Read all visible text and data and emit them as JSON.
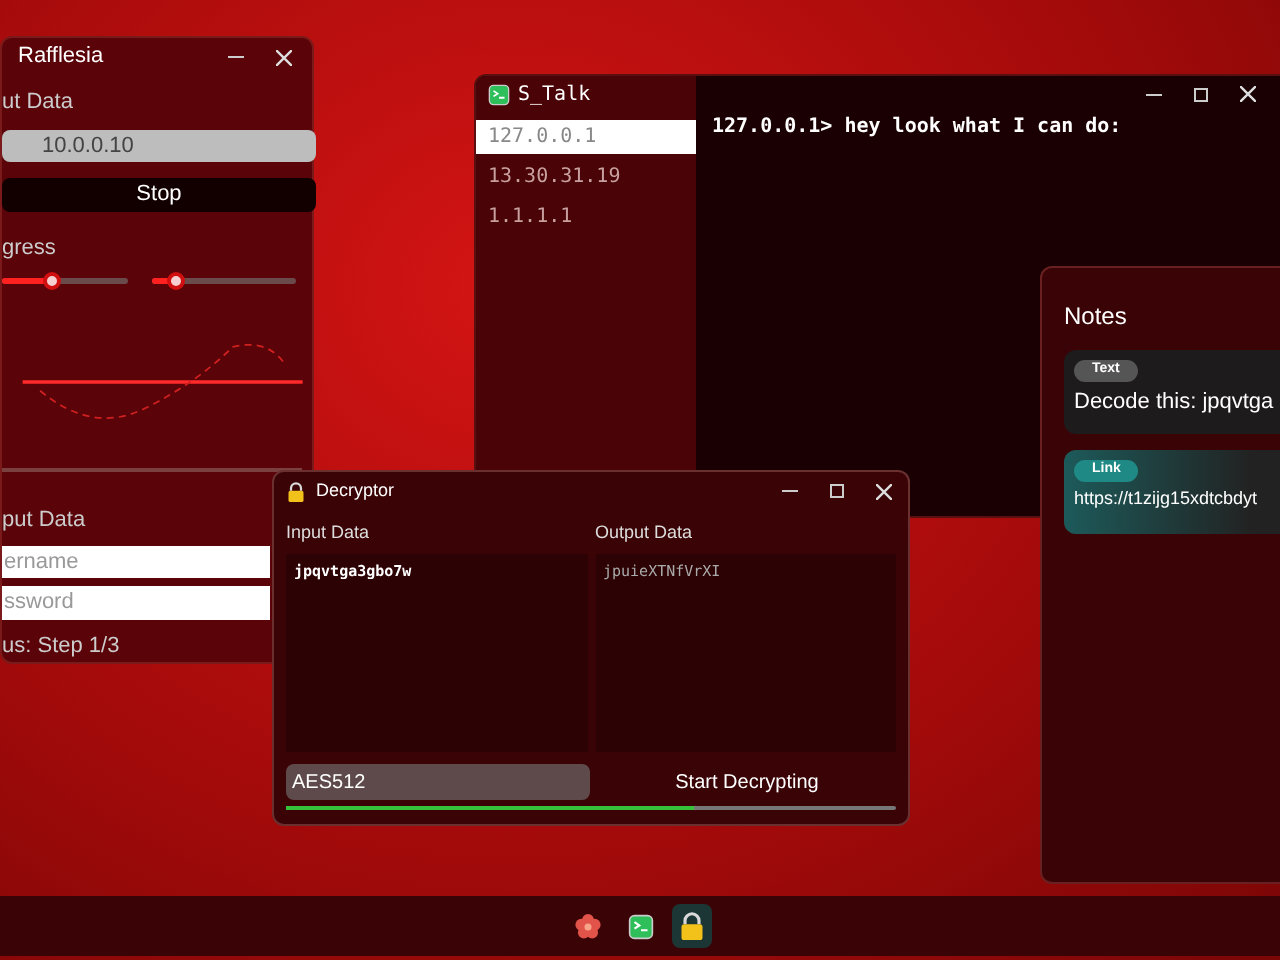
{
  "rafflesia": {
    "title": "Rafflesia",
    "input_label": "ut Data",
    "ip_value": "10.0.0.10",
    "stop_button": "Stop",
    "progress_label": "gress",
    "sliders": [
      {
        "level": 0.4
      },
      {
        "level": 0.16
      }
    ],
    "login_label": "put Data",
    "username_placeholder": "ername",
    "password_placeholder": "ssword",
    "status": "us: Step 1/3"
  },
  "s_talk": {
    "title": "S_Talk",
    "hosts": [
      {
        "label": "127.0.0.1",
        "selected": true
      },
      {
        "label": "13.30.31.19",
        "selected": false
      },
      {
        "label": "1.1.1.1",
        "selected": false
      }
    ],
    "messages": [
      "127.0.0.1> hey look what I can do:"
    ]
  },
  "notes": {
    "title": "Notes",
    "cards": [
      {
        "kind": "text",
        "tag": "Text",
        "content": "Decode this: jpqvtga"
      },
      {
        "kind": "link",
        "tag": "Link",
        "content": "https://t1zijg15xdtcbdyt"
      }
    ]
  },
  "decryptor": {
    "title": "Decryptor",
    "input_label": "Input Data",
    "output_label": "Output Data",
    "input_value": "jpqvtga3gbo7w",
    "output_value": "jpuieXTNfVrXI",
    "algorithm": "AES512",
    "start_button": "Start Decrypting",
    "progress": {
      "level": 0.67
    }
  },
  "taskbar": {
    "apps": [
      {
        "kind": "flower",
        "selected": false
      },
      {
        "kind": "chat",
        "selected": false
      },
      {
        "kind": "lock",
        "selected": true
      }
    ]
  }
}
